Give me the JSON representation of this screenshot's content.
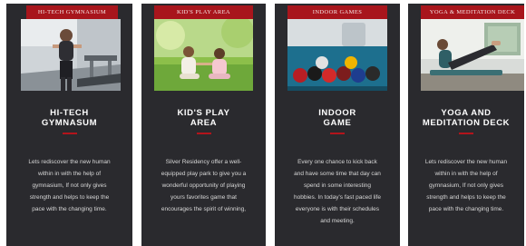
{
  "cards": [
    {
      "ribbon": "HI-TECH GYMNASIUM",
      "image_icon": "gym-treadmill-photo",
      "title_lines": [
        "HI-TECH",
        "GYMNASUM"
      ],
      "desc_lines": [
        "Lets rediscover the new human",
        "within in with the  help of",
        "gymnasium, If not only gives",
        "strength and helps to keep the",
        "pace with the changing time."
      ]
    },
    {
      "ribbon": "KID'S PLAY AREA",
      "image_icon": "kids-playing-photo",
      "title_lines": [
        "KID'S PLAY",
        "AREA"
      ],
      "desc_lines": [
        "Silver Residency offer a well-",
        "equipped play park to give you a",
        "wonderful opportunity of playing",
        "yours favorites game that",
        "encourages the spirit of winning,"
      ]
    },
    {
      "ribbon": "INDOOR GAMES",
      "image_icon": "billiard-balls-photo",
      "title_lines": [
        "INDOOR",
        "GAME"
      ],
      "desc_lines": [
        "Every one chance to kick back",
        "and have some time that day can",
        "spend in some interesting",
        "hobbies. In today's fast paced life",
        "everyone is with their schedules",
        "and meeting."
      ]
    },
    {
      "ribbon": "YOGA & MEDITATION DECK",
      "image_icon": "yoga-pose-photo",
      "title_lines": [
        "YOGA AND",
        "MEDITATION DECK"
      ],
      "desc_lines": [
        "Lets rediscover the new human",
        "within in with the  help of",
        "gymnasium, If not only gives",
        "strength and helps to keep the",
        "pace with the changing time."
      ]
    }
  ],
  "colors": {
    "card_bg": "#2a2a2e",
    "ribbon_red": "#a8151c",
    "divider_red": "#b3141b",
    "title_white": "#ffffff",
    "text_gray": "#d7d7d7"
  }
}
